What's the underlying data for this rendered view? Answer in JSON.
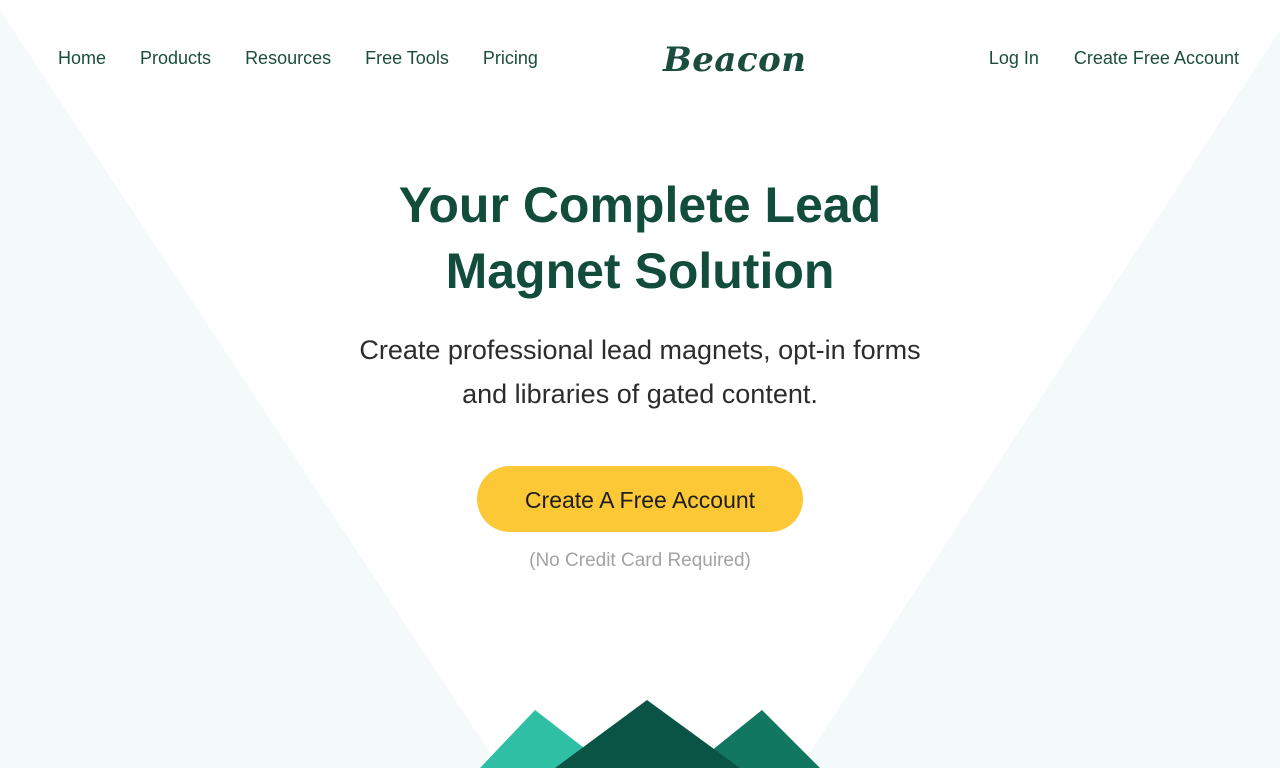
{
  "nav": {
    "items": [
      {
        "label": "Home"
      },
      {
        "label": "Products"
      },
      {
        "label": "Resources"
      },
      {
        "label": "Free Tools"
      },
      {
        "label": "Pricing"
      }
    ],
    "logo": "Beacon",
    "login_label": "Log In",
    "signup_label": "Create Free Account"
  },
  "hero": {
    "title": "Your Complete Lead Magnet Solution",
    "subtitle": "Create professional lead magnets, opt-in forms and libraries of gated content.",
    "cta_label": "Create A Free Account",
    "note": "(No Credit Card Required)"
  },
  "colors": {
    "brand_green": "#124d3c",
    "cta_yellow": "#fcc836",
    "mountain_light": "#2fbfa5",
    "mountain_mid": "#127760",
    "mountain_dark": "#0a5445"
  }
}
